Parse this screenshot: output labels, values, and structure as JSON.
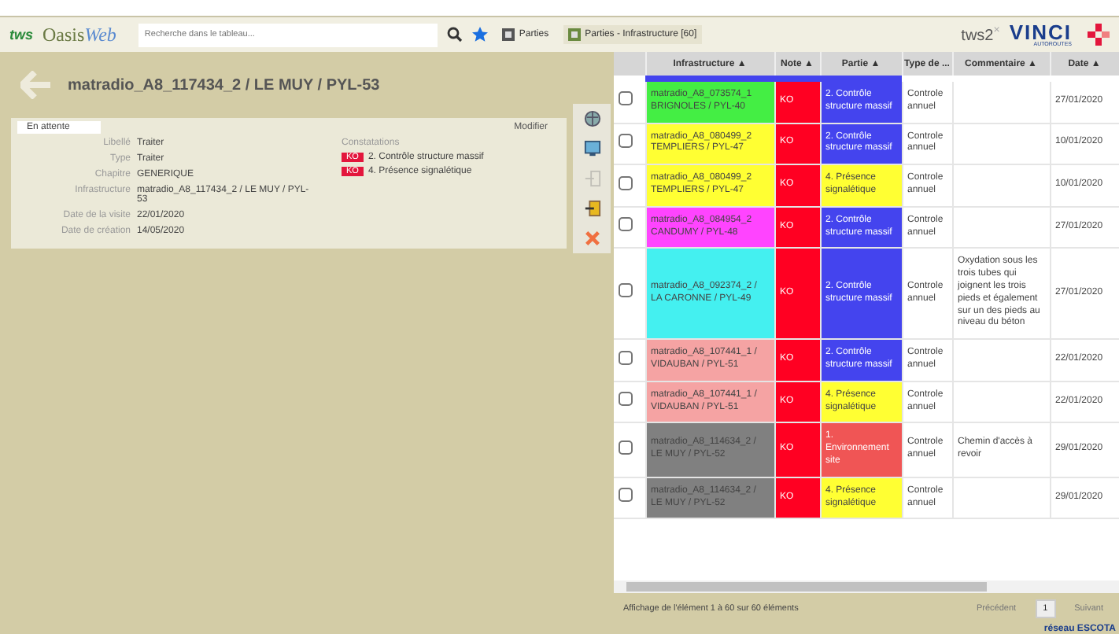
{
  "header": {
    "logo": "tws",
    "app_name": {
      "first": "Oasis",
      "second": "Web"
    },
    "search": {
      "placeholder": "Recherche dans le tableau..."
    },
    "tabs": [
      {
        "label": "Parties",
        "selected": false
      },
      {
        "label": "Parties - Infrastructure [60]",
        "selected": true
      }
    ],
    "user": {
      "name": "tws2",
      "close": "×"
    },
    "brand": {
      "name": "VINCI",
      "sub": "AUTOROUTES"
    }
  },
  "detail": {
    "title": "matradio_A8_117434_2 / LE MUY / PYL-53",
    "status": "En attente",
    "edit": "Modifier",
    "fields": [
      {
        "label": "Libellé",
        "value": "Traiter"
      },
      {
        "label": "Type",
        "value": "Traiter"
      },
      {
        "label": "Chapitre",
        "value": "GENERIQUE"
      },
      {
        "label": "Infrastructure",
        "value": "matradio_A8_117434_2 / LE MUY / PYL-53"
      },
      {
        "label": "Date de la visite",
        "value": "22/01/2020"
      },
      {
        "label": "Date de création",
        "value": "14/05/2020"
      }
    ],
    "findings_title": "Constatations",
    "findings": [
      {
        "badge": "KO",
        "text": "2. Contrôle structure massif"
      },
      {
        "badge": "KO",
        "text": "4. Présence signalétique"
      }
    ]
  },
  "tools": [
    {
      "kind": "globe",
      "disabled": false
    },
    {
      "kind": "screen",
      "disabled": false
    },
    {
      "kind": "enter",
      "disabled": true
    },
    {
      "kind": "export",
      "disabled": false
    },
    {
      "kind": "close",
      "disabled": false
    }
  ],
  "table": {
    "columns": [
      {
        "label": "Infrastructure",
        "sort": "▲"
      },
      {
        "label": "Note",
        "sort": "▲"
      },
      {
        "label": "Partie",
        "sort": "▲"
      },
      {
        "label": "Type de ..."
      },
      {
        "label": "Commentaire",
        "sort": "▲"
      },
      {
        "label": "Date",
        "sort": "▲"
      }
    ],
    "rows": [
      {
        "selected": false,
        "infrastructure": {
          "text": "matradio_A8_073574_1 BRIGNOLES / PYL-40",
          "color": "#44ee44"
        },
        "note": {
          "text": "KO",
          "color": "#ff0022"
        },
        "partie": {
          "text": "2. Contrôle structure massif",
          "color": "#4444ee"
        },
        "type": "Controle annuel",
        "comment": "",
        "date": "27/01/2020"
      },
      {
        "selected": false,
        "infrastructure": {
          "text": "matradio_A8_080499_2 TEMPLIERS / PYL-47",
          "color": "#ffff33"
        },
        "note": {
          "text": "KO",
          "color": "#ff0022"
        },
        "partie": {
          "text": "2. Contrôle structure massif",
          "color": "#4444ee"
        },
        "type": "Controle annuel",
        "comment": "",
        "date": "10/01/2020"
      },
      {
        "selected": false,
        "infrastructure": {
          "text": "matradio_A8_080499_2 TEMPLIERS / PYL-47",
          "color": "#ffff33"
        },
        "note": {
          "text": "KO",
          "color": "#ff0022"
        },
        "partie": {
          "text": "4. Présence signalétique",
          "color": "#ffff33"
        },
        "type": "Controle annuel",
        "comment": "",
        "date": "10/01/2020"
      },
      {
        "selected": false,
        "infrastructure": {
          "text": "matradio_A8_084954_2 CANDUMY / PYL-48",
          "color": "#ff44ff"
        },
        "note": {
          "text": "KO",
          "color": "#ff0022"
        },
        "partie": {
          "text": "2. Contrôle structure massif",
          "color": "#4444ee"
        },
        "type": "Controle annuel",
        "comment": "",
        "date": "27/01/2020"
      },
      {
        "selected": false,
        "infrastructure": {
          "text": "matradio_A8_092374_2 / LA CARONNE / PYL-49",
          "color": "#44f0f0"
        },
        "note": {
          "text": "KO",
          "color": "#ff0022"
        },
        "partie": {
          "text": "2. Contrôle structure massif",
          "color": "#4444ee"
        },
        "type": "Controle annuel",
        "comment": "Oxydation sous les trois tubes qui joignent les trois pieds et également sur un des pieds au niveau du béton",
        "date": "27/01/2020"
      },
      {
        "selected": false,
        "infrastructure": {
          "text": "matradio_A8_107441_1 / VIDAUBAN / PYL-51",
          "color": "#f5a3a3"
        },
        "note": {
          "text": "KO",
          "color": "#ff0022"
        },
        "partie": {
          "text": "2. Contrôle structure massif",
          "color": "#4444ee"
        },
        "type": "Controle annuel",
        "comment": "",
        "date": "22/01/2020"
      },
      {
        "selected": false,
        "infrastructure": {
          "text": "matradio_A8_107441_1 / VIDAUBAN / PYL-51",
          "color": "#f5a3a3"
        },
        "note": {
          "text": "KO",
          "color": "#ff0022"
        },
        "partie": {
          "text": "4. Présence signalétique",
          "color": "#ffff33"
        },
        "type": "Controle annuel",
        "comment": "",
        "date": "22/01/2020"
      },
      {
        "selected": false,
        "infrastructure": {
          "text": "matradio_A8_114634_2 / LE MUY / PYL-52",
          "color": "#808080"
        },
        "note": {
          "text": "KO",
          "color": "#ff0022"
        },
        "partie": {
          "text": "1. Environnement site",
          "color": "#f05555"
        },
        "type": "Controle annuel",
        "comment": "Chemin d'accès à revoir",
        "date": "29/01/2020"
      },
      {
        "selected": false,
        "infrastructure": {
          "text": "matradio_A8_114634_2 / LE MUY / PYL-52",
          "color": "#808080"
        },
        "note": {
          "text": "KO",
          "color": "#ff0022"
        },
        "partie": {
          "text": "4. Présence signalétique",
          "color": "#ffff33"
        },
        "type": "Controle annuel",
        "comment": "",
        "date": "29/01/2020"
      }
    ]
  },
  "footer": {
    "info": "Affichage de l'élément 1 à 60 sur 60 éléments",
    "pages": [
      {
        "label": "Précédent",
        "disabled": true,
        "selected": false
      },
      {
        "label": "1",
        "disabled": false,
        "selected": true
      },
      {
        "label": "Suivant",
        "disabled": true,
        "selected": false
      }
    ]
  },
  "network": "réseau ESCOTA"
}
